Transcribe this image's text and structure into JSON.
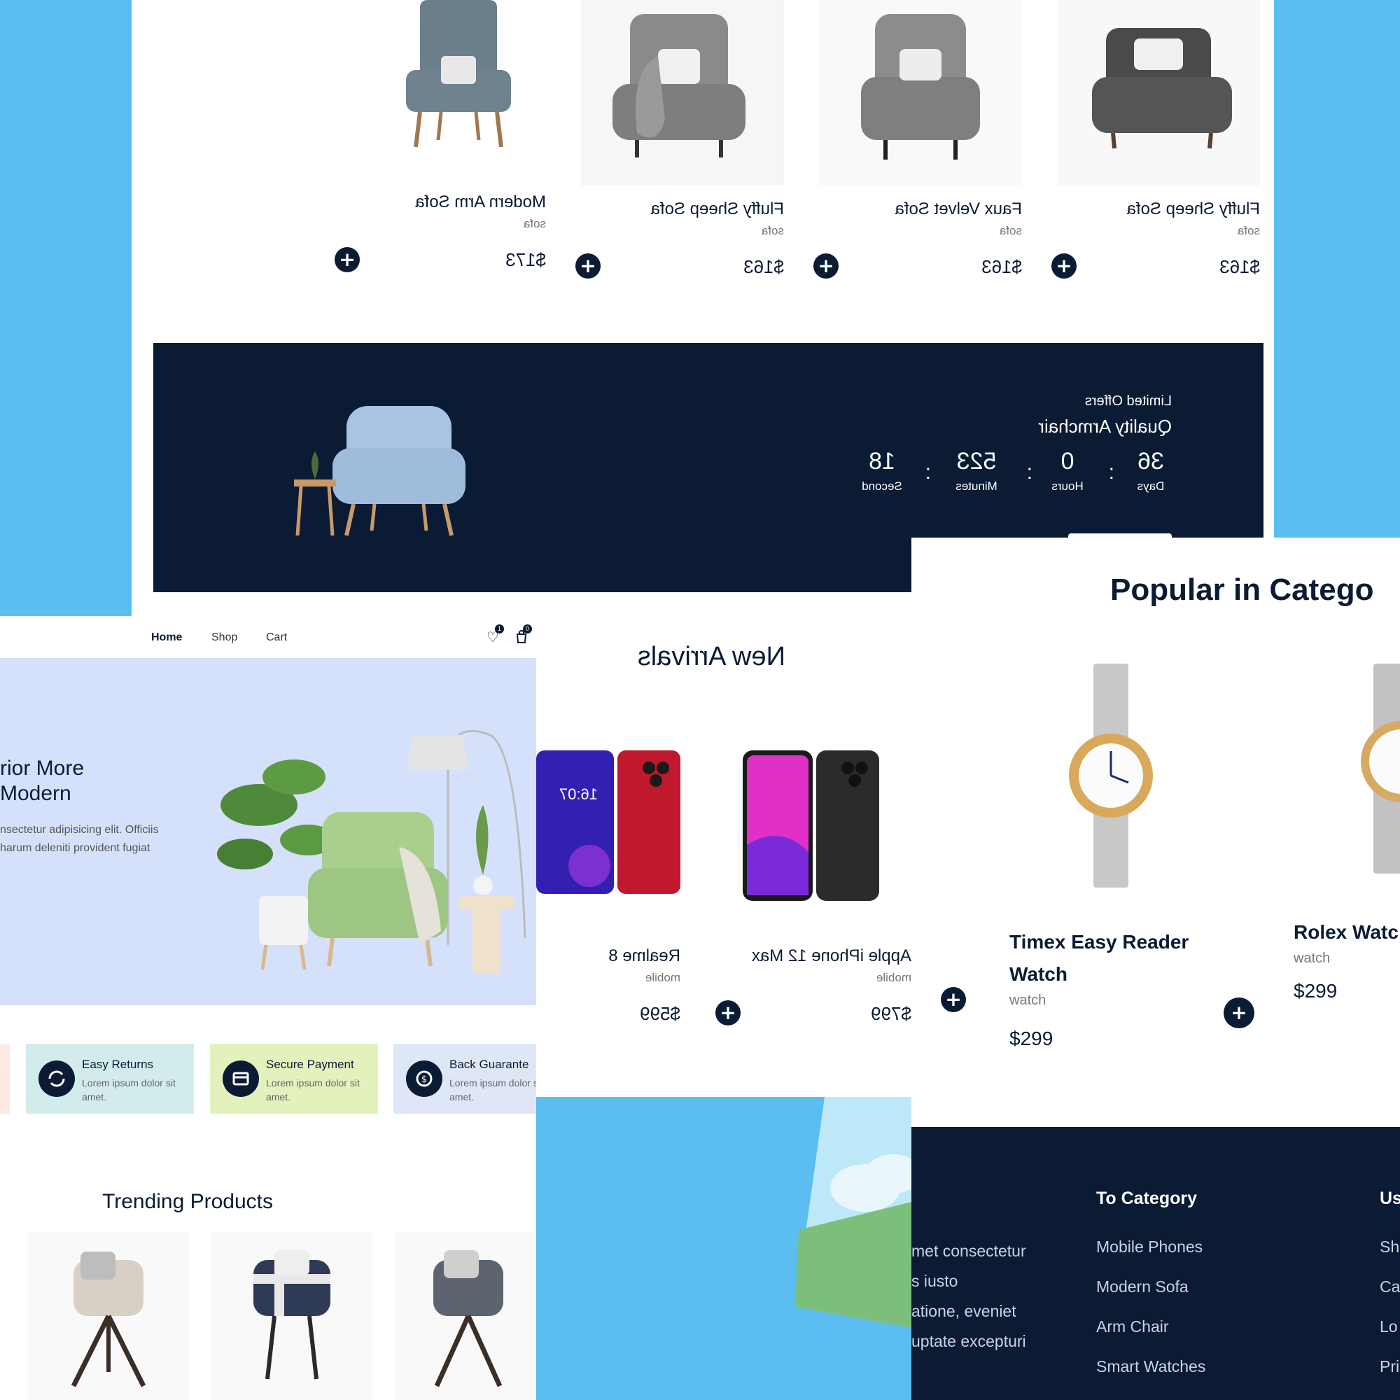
{
  "top_products": {
    "items": [
      {
        "name": "Modern Arm Sofa",
        "category": "sofa",
        "price": "$173"
      },
      {
        "name": "Fluffy Sheep Sofa",
        "category": "sofa",
        "price": "$163"
      },
      {
        "name": "Faux Velvet Sofa",
        "category": "sofa",
        "price": "$163"
      },
      {
        "name": "Fluffy Sheep Sofa",
        "category": "sofa",
        "price": "$163"
      }
    ]
  },
  "offer": {
    "label": "Limited Offers",
    "title": "Quality Armchair",
    "countdown": [
      {
        "value": "36",
        "unit": "Days"
      },
      {
        "value": "0",
        "unit": "Hours"
      },
      {
        "value": "523",
        "unit": "Minutes"
      },
      {
        "value": "18",
        "unit": "Second"
      }
    ],
    "separator": ":"
  },
  "nav": {
    "links": [
      "Home",
      "Shop",
      "Cart"
    ],
    "wishlist_count": "1",
    "cart_count": "0"
  },
  "hero": {
    "title_line1": "rior More",
    "title_line2": "Modern",
    "desc_line1": "nsectetur adipisicing elit. Officiis",
    "desc_line2": "harum deleniti provident fugiat"
  },
  "features": [
    {
      "title": "Easy Returns",
      "desc": "Lorem ipsum dolor sit amet.",
      "bg": "#d2ecec",
      "icon": "refresh-icon"
    },
    {
      "title": "Secure Payment",
      "desc": "Lorem ipsum dolor sit amet.",
      "bg": "#e3f2bd",
      "icon": "card-icon"
    },
    {
      "title": "Back Guarante",
      "desc": "Lorem ipsum dolor sit amet.",
      "bg": "#dfe7f7",
      "icon": "money-back-icon"
    }
  ],
  "trending": {
    "title": "Trending Products"
  },
  "new_arrivals": {
    "title": "New Arrivals",
    "items": [
      {
        "name": "Realme 8",
        "category": "mobile",
        "price": "$599"
      },
      {
        "name": "Apple iPhone 12 Max",
        "category": "mobile",
        "price": "$799"
      }
    ],
    "phone_time": "16:07"
  },
  "popular": {
    "title": "Popular in Catego",
    "items": [
      {
        "name_line1": "Timex Easy Reader",
        "name_line2": "Watch",
        "category": "watch",
        "price": "$299"
      },
      {
        "name_line1": "Rolex Watc",
        "name_line2": "",
        "category": "watch",
        "price": "$299"
      }
    ]
  },
  "footer": {
    "about_lines": [
      "met consectetur",
      "s iusto",
      "atione, eveniet",
      "uptate excepturi"
    ],
    "category_title": "To Category",
    "category_links": [
      "Mobile Phones",
      "Modern Sofa",
      "Arm Chair",
      "Smart Watches"
    ],
    "useful_title": "Us",
    "useful_links": [
      "Sh",
      "Ca",
      "Lo",
      "Pri"
    ]
  },
  "colors": {
    "navy": "#0b1b34",
    "sky": "#5bbdf0",
    "hero_bg": "#d5e1fa"
  }
}
